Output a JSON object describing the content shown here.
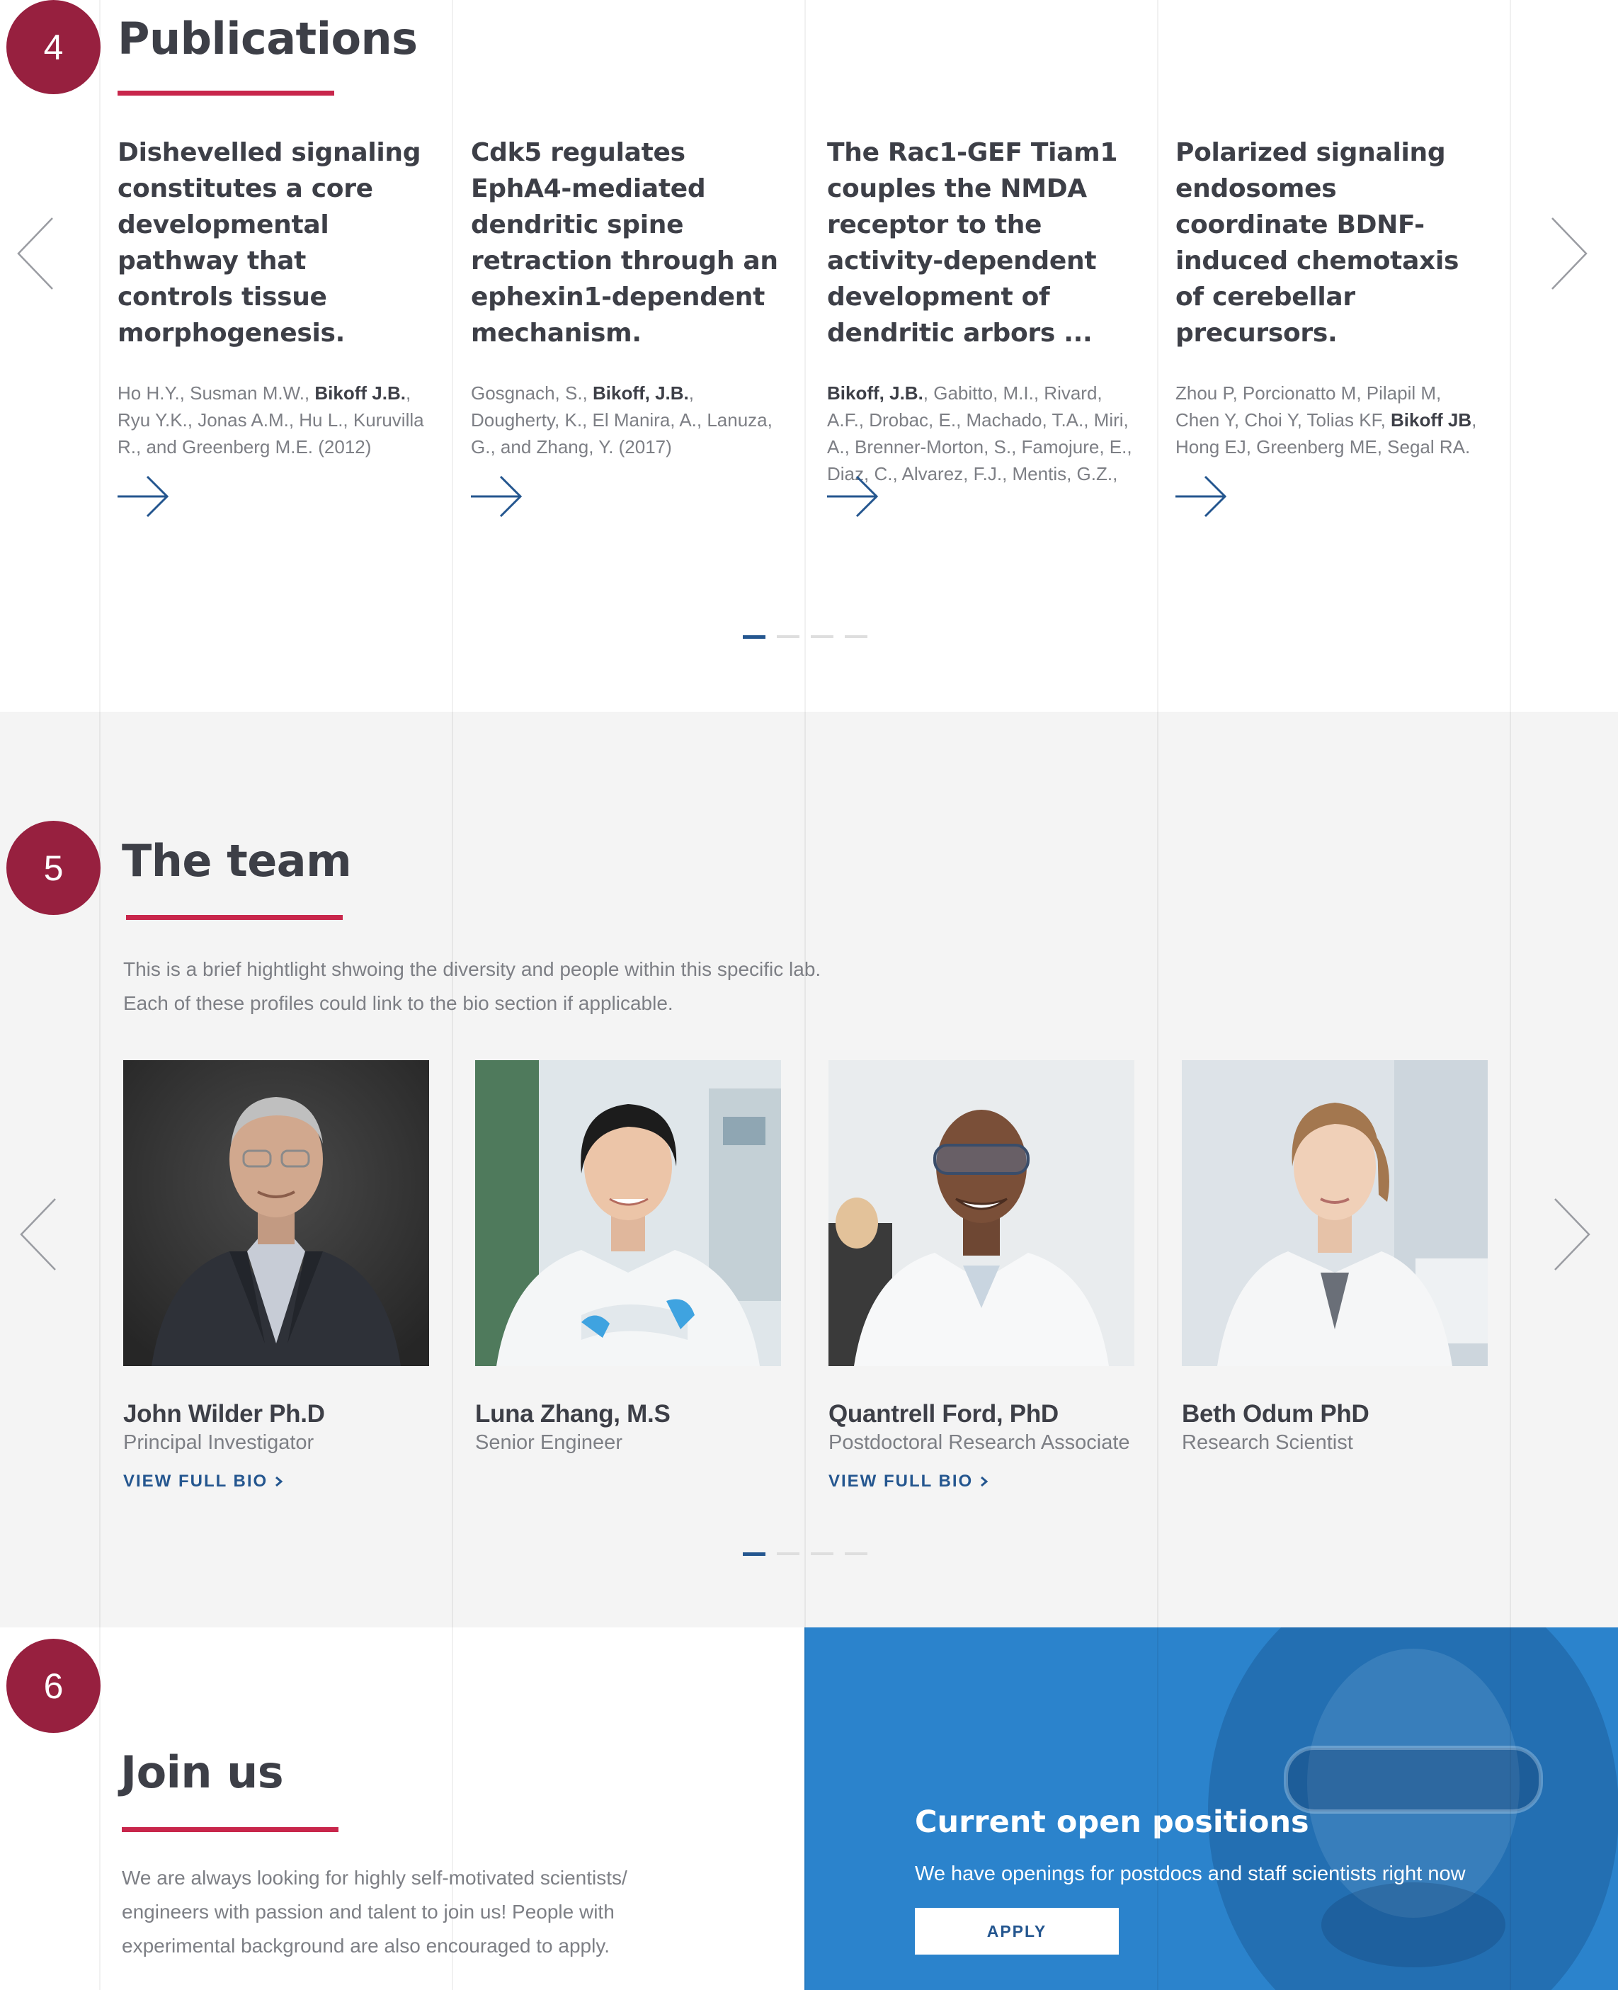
{
  "publications": {
    "step_number": "4",
    "title": "Publications",
    "items": [
      {
        "title": "Dishevelled signaling constitutes a core developmental pathway that controls tissue morphogenesis.",
        "authors_before": "Ho H.Y., Susman M.W., ",
        "authors_bold": "Bikoff J.B.",
        "authors_after": ", Ryu Y.K., Jonas A.M., Hu L., Kuruvilla R., and Greenberg M.E. (2012)"
      },
      {
        "title": "Cdk5 regulates EphA4-mediated dendritic spine retraction through an ephexin1-dependent mechanism.",
        "authors_before": "Gosgnach, S., ",
        "authors_bold": "Bikoff, J.B.",
        "authors_after": ", Dougherty, K., El Manira, A., Lanuza, G., and Zhang, Y. (2017)"
      },
      {
        "title": "The Rac1-GEF Tiam1 couples the NMDA receptor to the activity-dependent development of dendritic arbors ...",
        "authors_before": "",
        "authors_bold": "Bikoff, J.B.",
        "authors_after": ", Gabitto, M.I., Rivard, A.F., Drobac, E., Machado, T.A., Miri, A., Brenner-Morton, S., Famojure, E., Diaz, C., Alvarez, F.J., Mentis, G.Z., and"
      },
      {
        "title": "Polarized signaling endosomes coordinate BDNF-induced chemotaxis of cerebellar precursors.",
        "authors_before": "Zhou P, Porcionatto M, Pilapil M, Chen Y, Choi Y, Tolias KF, ",
        "authors_bold": "Bikoff JB",
        "authors_after": ", Hong EJ, Greenberg ME, Segal RA."
      }
    ],
    "pagination": {
      "total": 4,
      "active": 1
    }
  },
  "team": {
    "step_number": "5",
    "title": "The team",
    "intro_line1": "This is a brief hightlight shwoing the diversity and people within this specific lab.",
    "intro_line2": "Each of these profiles could link to the bio section if applicable.",
    "members": [
      {
        "name": "John Wilder Ph.D",
        "role": "Principal Investigator",
        "link": "VIEW FULL BIO"
      },
      {
        "name": "Luna Zhang, M.S",
        "role": "Senior Engineer"
      },
      {
        "name": "Quantrell Ford, PhD",
        "role": "Postdoctoral Research Associate",
        "link": "VIEW FULL BIO"
      },
      {
        "name": "Beth Odum PhD",
        "role": "Research Scientist"
      }
    ],
    "pagination": {
      "total": 4,
      "active": 1
    }
  },
  "join": {
    "step_number": "6",
    "title": "Join us",
    "text": "We are always looking for highly self-motivated scientists/ engineers with passion and talent to join us! People with experimental background are also encouraged to apply.",
    "panel": {
      "title": "Current open positions",
      "subtitle": "We have openings for postdocs and staff scientists right now",
      "button": "APPLY"
    }
  },
  "colors": {
    "badge": "#97203f",
    "underline": "#c8264b",
    "link": "#24568f",
    "panel": "#2b83cc",
    "team_bg": "#f4f4f4"
  },
  "icons": [
    "arrow-right-icon",
    "chevron-left-icon",
    "chevron-right-icon",
    "chevron-small-right-icon"
  ]
}
